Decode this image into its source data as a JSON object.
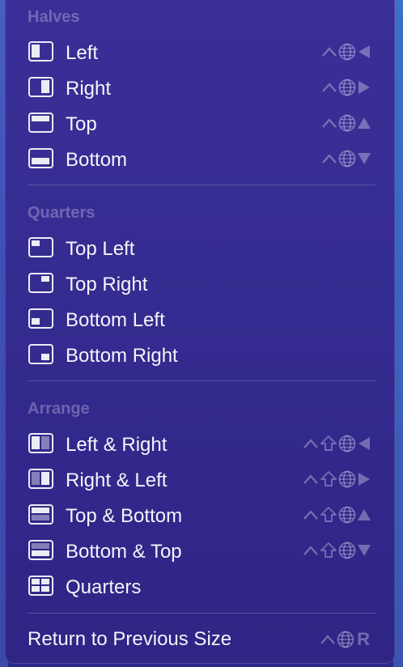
{
  "sections": {
    "halves": "Halves",
    "quarters": "Quarters",
    "arrange": "Arrange"
  },
  "items": {
    "left": "Left",
    "right": "Right",
    "top": "Top",
    "bottom": "Bottom",
    "top_left": "Top Left",
    "top_right": "Top Right",
    "bottom_left": "Bottom Left",
    "bottom_right": "Bottom Right",
    "left_right": "Left & Right",
    "right_left": "Right & Left",
    "top_bottom": "Top & Bottom",
    "bottom_top": "Bottom & Top",
    "quarters": "Quarters",
    "return_prev": "Return to Previous Size"
  },
  "shortcuts": {
    "return_key": "R"
  }
}
